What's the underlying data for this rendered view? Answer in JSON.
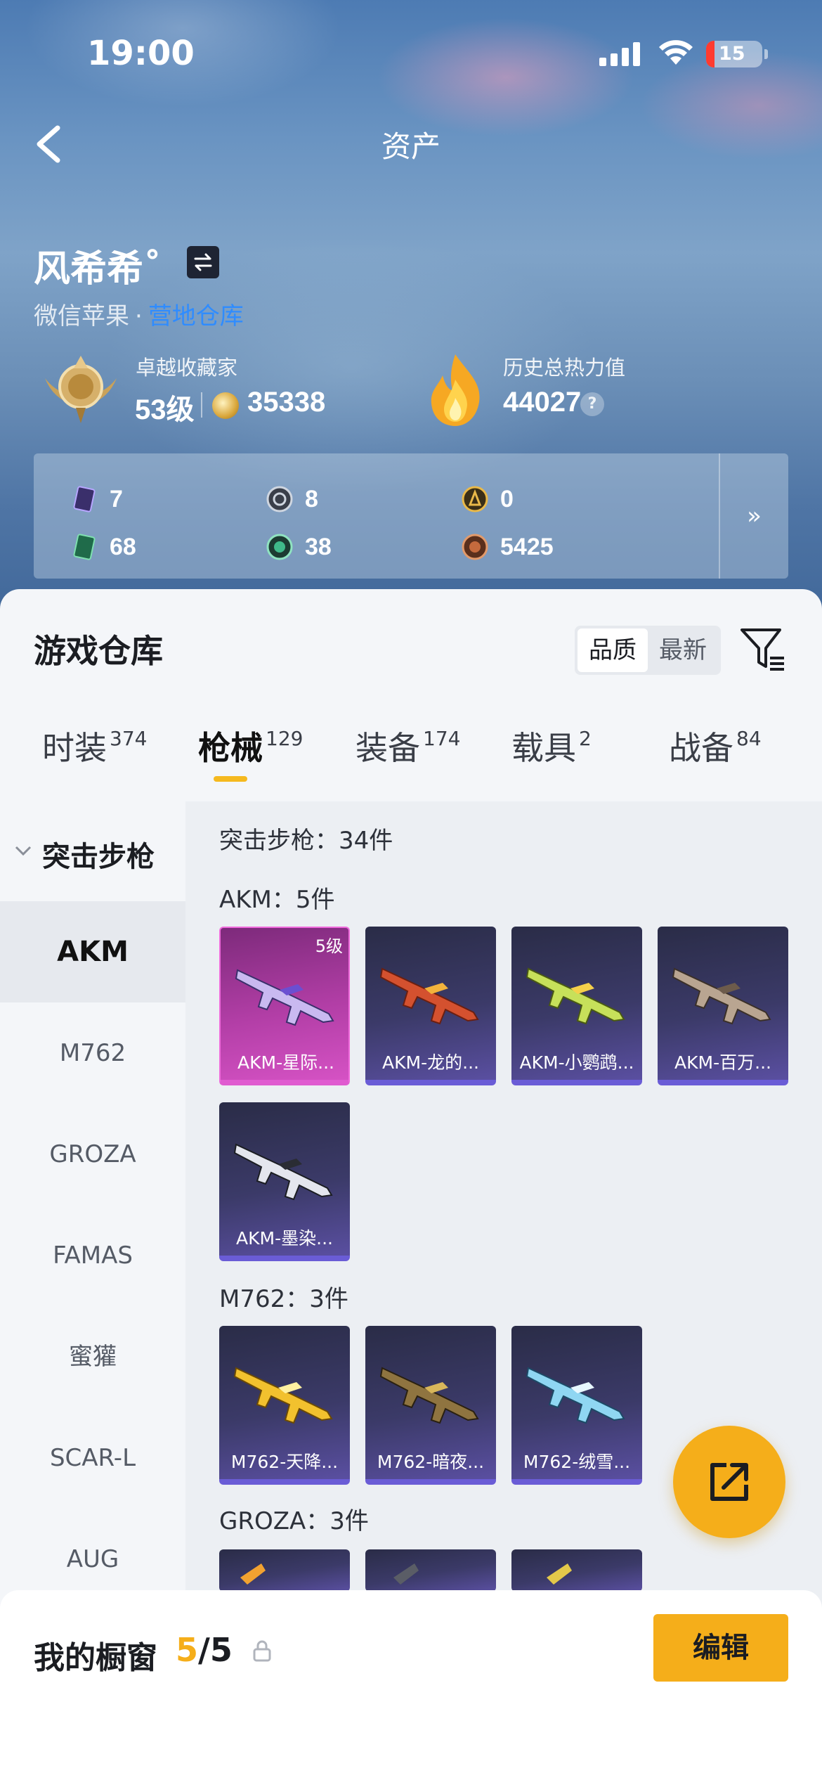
{
  "status_bar": {
    "time": "19:00",
    "battery": "15",
    "battery_level": 0.15
  },
  "header": {
    "title": "资产"
  },
  "profile": {
    "username": "风希希˚",
    "platform": "微信苹果",
    "platform_dot": "·",
    "platform_link": "营地仓库"
  },
  "stats": {
    "collector_label": "卓越收藏家",
    "level": "53级",
    "coins": "35338",
    "heat_label": "历史总热力值",
    "heat_value": "44027",
    "help": "?"
  },
  "counts": [
    {
      "icon": "card-icon",
      "value": "7"
    },
    {
      "icon": "silver-coin-icon",
      "value": "8"
    },
    {
      "icon": "gold-token-icon",
      "value": "0"
    },
    {
      "icon": "green-card-icon",
      "value": "68"
    },
    {
      "icon": "green-gem-icon",
      "value": "38"
    },
    {
      "icon": "bronze-token-icon",
      "value": "5425"
    }
  ],
  "counts_more": "»",
  "warehouse": {
    "title": "游戏仓库",
    "sort_options": [
      "品质",
      "最新"
    ],
    "tabs": [
      {
        "label": "时装",
        "count": "374"
      },
      {
        "label": "枪械",
        "count": "129"
      },
      {
        "label": "装备",
        "count": "174"
      },
      {
        "label": "载具",
        "count": "2"
      },
      {
        "label": "战备",
        "count": "84"
      }
    ],
    "active_tab": 1
  },
  "side_nav": {
    "group": "突击步枪",
    "items": [
      "AKM",
      "M762",
      "GROZA",
      "FAMAS",
      "蜜獾",
      "SCAR-L",
      "AUG"
    ],
    "active": 0
  },
  "content": {
    "summary": "突击步枪：34件",
    "sections": [
      {
        "heading": "AKM：5件",
        "cards": [
          {
            "name": "AKM-星际...",
            "level": "5级",
            "style": "pink"
          },
          {
            "name": "AKM-龙的...",
            "style": "blue"
          },
          {
            "name": "AKM-小鹦鹉...",
            "style": "blue"
          },
          {
            "name": "AKM-百万...",
            "style": "blue"
          },
          {
            "name": "AKM-墨染...",
            "style": "blue"
          }
        ]
      },
      {
        "heading": "M762：3件",
        "cards": [
          {
            "name": "M762-天降...",
            "style": "blue"
          },
          {
            "name": "M762-暗夜...",
            "style": "blue"
          },
          {
            "name": "M762-绒雪...",
            "style": "blue"
          }
        ]
      },
      {
        "heading": "GROZA：3件"
      }
    ]
  },
  "showcase": {
    "title": "我的橱窗",
    "current": "5",
    "total": "/5",
    "edit_label": "编辑"
  },
  "colors": {
    "accent": "#f5ae1a",
    "link": "#2f8cff",
    "card_purple": "#6a5cd6",
    "card_pink": "#e05bd0"
  }
}
